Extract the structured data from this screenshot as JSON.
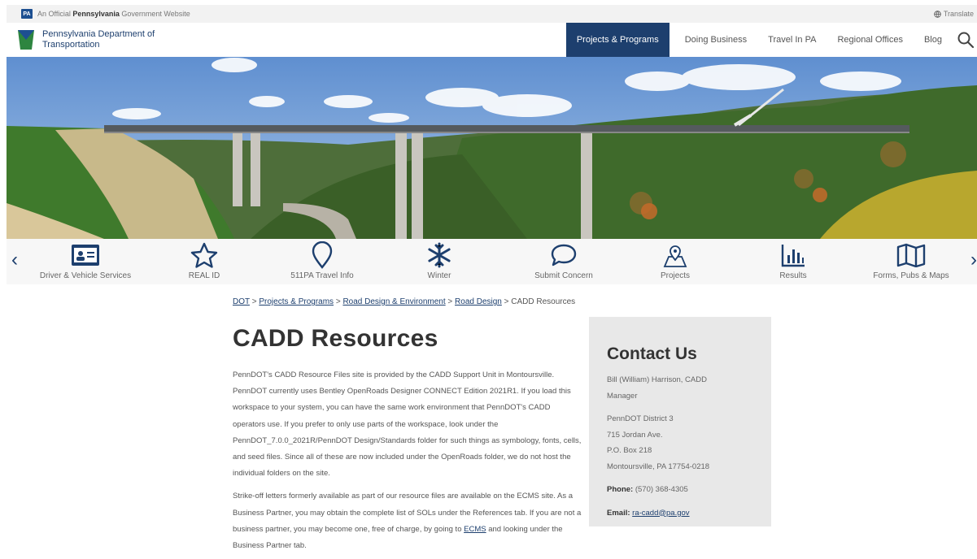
{
  "topbar": {
    "badge": "PA",
    "official_prefix": "An Official ",
    "official_bold": "Pennsylvania",
    "official_suffix": " Government Website",
    "translate_label": "Translate",
    "translate_icon": "globe-icon"
  },
  "header": {
    "agency_line1": "Pennsylvania Department of",
    "agency_line2": "Transportation",
    "logo_icon": "keystone-icon",
    "nav": [
      "Projects & Programs",
      "Doing Business",
      "Travel In PA",
      "Regional Offices",
      "Blog"
    ],
    "search_icon": "search-icon",
    "colors": {
      "primary": "#1d3f6e",
      "keystone_green": "#2e8540",
      "keystone_blue": "#1d4f91"
    }
  },
  "quicklinks": {
    "items": [
      {
        "label": "Driver & Vehicle Services",
        "icon": "id-card-icon"
      },
      {
        "label": "REAL ID",
        "icon": "star-icon"
      },
      {
        "label": "511PA Travel Info",
        "icon": "location-pin-icon"
      },
      {
        "label": "Winter",
        "icon": "snowflake-icon"
      },
      {
        "label": "Submit Concern",
        "icon": "speech-bubble-icon"
      },
      {
        "label": "Projects",
        "icon": "map-pin-icon"
      },
      {
        "label": "Results",
        "icon": "bar-chart-icon"
      },
      {
        "label": "Forms, Pubs & Maps",
        "icon": "map-icon"
      }
    ],
    "prev_icon": "chevron-left-icon",
    "next_icon": "chevron-right-icon"
  },
  "breadcrumb": {
    "items": [
      "DOT",
      "Projects & Programs",
      "Road Design & Environment",
      "Road Design"
    ],
    "separator": ">",
    "current": "CADD Resources"
  },
  "main": {
    "title": "CADD Resources",
    "p1": "PennDOT's CADD Resource Files site is provided by the CADD Support Unit in Montoursville. PennDOT currently uses Bentley OpenRoads Designer CONNECT Edition 2021R1. If you load this workspace to your system, you can have the same work environment that PennDOT's CADD operators use. If you prefer to only use parts of the workspace, look under the PennDOT_7.0.0_2021R/PennDOT Design/Standards folder for such things as symbology, fonts, cells, and seed files. Since all of these are now included under the OpenRoads folder, we do not host the individual folders on the site.",
    "p2_part1": "Strike-off letters formerly available as part of our resource files are available on the ECMS site. As a Business Partner, you may obtain the complete list of SOLs under the References tab. If you are not a business partner, you may become one, free of charge, by going to ",
    "p2_link": "ECMS",
    "p2_part2": " and looking under the Business Partner tab."
  },
  "contact": {
    "title": "Contact Us",
    "name_line1": "Bill (William) Harrison, CADD",
    "name_line2": "Manager",
    "office": "PennDOT District 3",
    "street": "715 Jordan Ave.",
    "pobox": "P.O. Box 218",
    "city": "Montoursville, PA 17754-0218",
    "phone_label": "Phone:",
    "phone": " (570) 368-4305",
    "email_label": "Email:",
    "email": "ra-cadd@pa.gov"
  }
}
